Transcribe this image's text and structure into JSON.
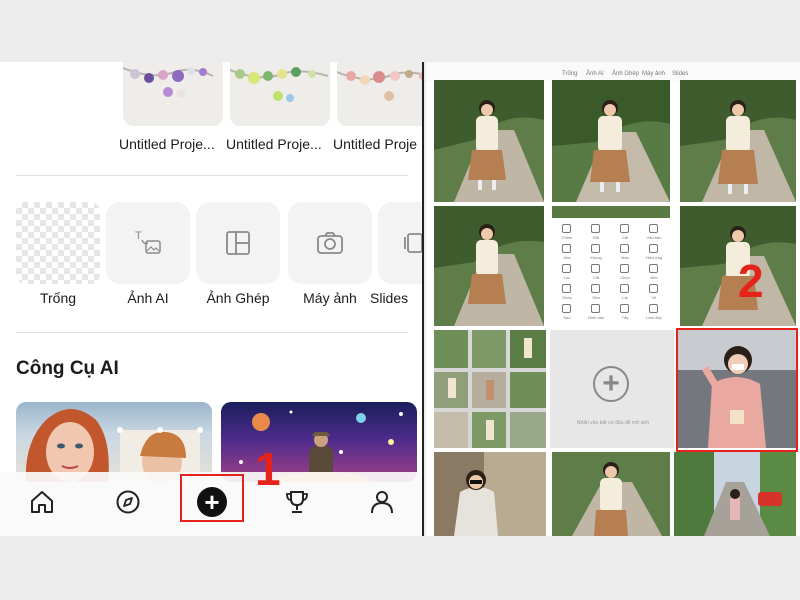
{
  "projects": [
    {
      "title": "Untitled Proje..."
    },
    {
      "title": "Untitled Proje..."
    },
    {
      "title": "Untitled Proje..."
    },
    {
      "title": "Untitled Proje"
    }
  ],
  "create_options": [
    {
      "label": "Trống",
      "icon": "blank-canvas-icon"
    },
    {
      "label": "Ảnh AI",
      "icon": "ai-image-icon"
    },
    {
      "label": "Ảnh Ghép",
      "icon": "collage-icon"
    },
    {
      "label": "Máy ảnh",
      "icon": "camera-icon"
    },
    {
      "label": "Slides",
      "icon": "slides-icon"
    }
  ],
  "ai_tools": {
    "title": "Công Cụ AI"
  },
  "bottom_nav": [
    {
      "name": "home",
      "icon": "home-icon"
    },
    {
      "name": "explore",
      "icon": "compass-icon"
    },
    {
      "name": "create",
      "icon": "plus-icon",
      "glyph": "+"
    },
    {
      "name": "challenges",
      "icon": "trophy-icon"
    },
    {
      "name": "profile",
      "icon": "user-icon"
    }
  ],
  "annotations": {
    "step1": "1",
    "step2": "2",
    "highlight_color": "#e5231b"
  },
  "right_topbar": [
    "Trống",
    "Ảnh AI",
    "Ảnh Ghép",
    "Máy ảnh",
    "Slides"
  ],
  "add_tile": {
    "glyph": "+",
    "caption": "Nhấn vào bất cứ đâu để mở ảnh"
  },
  "menu_items": [
    "Chỉnh",
    "Đổi",
    "Cắt",
    "Văn bản",
    "Xóa",
    "Khung",
    "Màu",
    "Hiệu ứng",
    "Lọc",
    "Cắt",
    "Chọn",
    "Nền",
    "Ghép",
    "Sửa",
    "Lật",
    "Vẽ",
    "Sao",
    "Hình dán",
    "Tẩy",
    "Làm đẹp"
  ]
}
